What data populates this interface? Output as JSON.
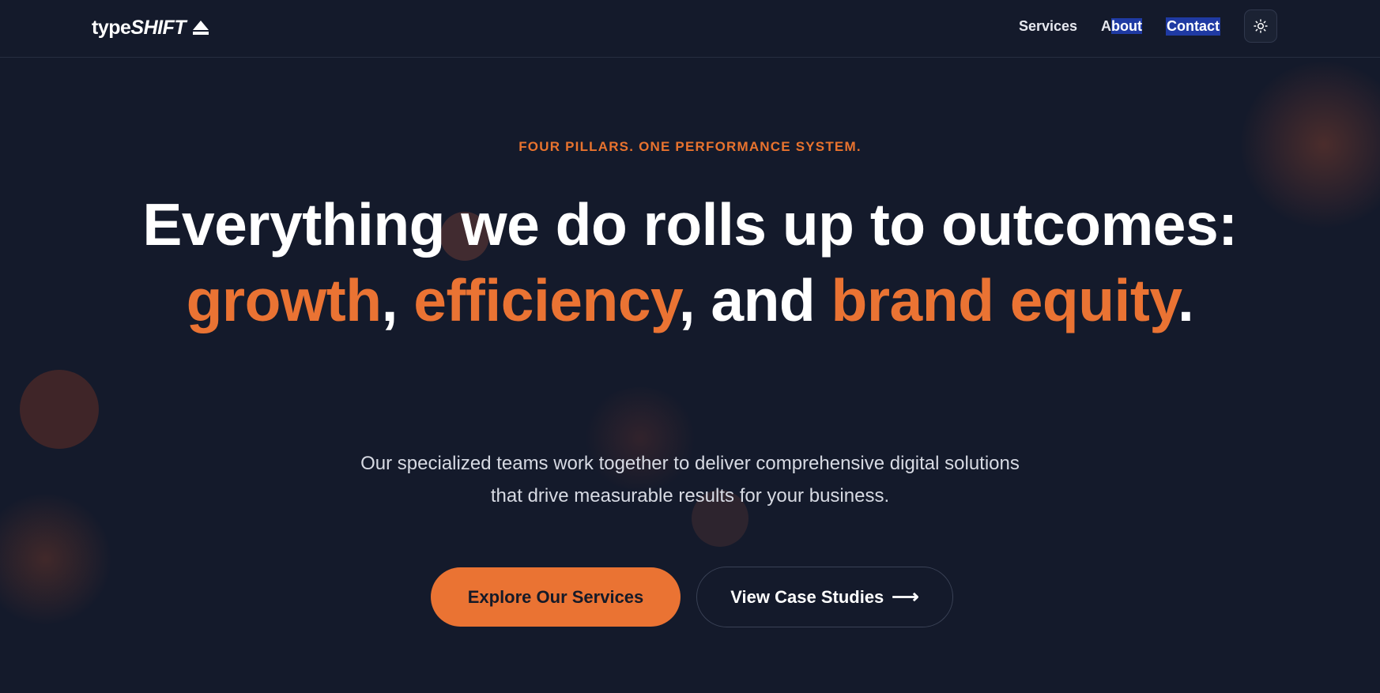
{
  "brand": {
    "name_part1": "type",
    "name_part2": "SHIFT",
    "logo_icon": "eject-triangle-icon"
  },
  "nav": {
    "items": [
      {
        "label": "Services"
      },
      {
        "label_first": "A",
        "label_rest": "bout"
      },
      {
        "label": "Contact"
      }
    ],
    "theme_toggle_icon": "sun-icon"
  },
  "hero": {
    "eyebrow": "FOUR PILLARS. ONE PERFORMANCE SYSTEM.",
    "headline": {
      "part1": "Everything we do rolls up to outcomes: ",
      "growth": "growth",
      "comma1": ", ",
      "efficiency": "efficiency",
      "comma2": ", and ",
      "brand_equity": "brand equity",
      "period": "."
    },
    "subtitle_line1": "Our specialized teams work together to deliver comprehensive digital solutions",
    "subtitle_line2": "that drive measurable results for your business.",
    "primary_cta": "Explore Our Services",
    "secondary_cta": "View Case Studies",
    "secondary_cta_icon": "arrow-right-icon"
  },
  "colors": {
    "background": "#141a2b",
    "accent": "#ea7333",
    "selection": "#1f3aa3"
  }
}
